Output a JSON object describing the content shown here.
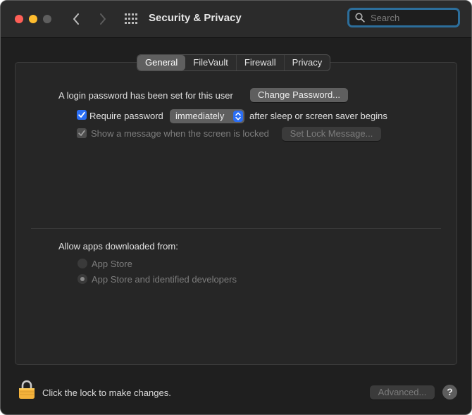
{
  "window": {
    "title": "Security & Privacy",
    "search": {
      "placeholder": "Search",
      "value": ""
    }
  },
  "toolbar": {
    "back_icon": "chevron-left-icon",
    "forward_icon": "chevron-right-icon",
    "show_all_icon": "grid-icon"
  },
  "tabs": [
    {
      "label": "General",
      "selected": true
    },
    {
      "label": "FileVault",
      "selected": false
    },
    {
      "label": "Firewall",
      "selected": false
    },
    {
      "label": "Privacy",
      "selected": false
    }
  ],
  "general": {
    "login_password_text": "A login password has been set for this user",
    "change_password_button": "Change Password...",
    "require_password": {
      "label": "Require password",
      "checked": true,
      "popup_value": "immediately",
      "suffix": "after sleep or screen saver begins"
    },
    "show_message": {
      "label": "Show a message when the screen is locked",
      "checked": true,
      "enabled": false,
      "button": "Set Lock Message..."
    },
    "allow_apps": {
      "label": "Allow apps downloaded from:",
      "options": [
        {
          "label": "App Store",
          "selected": false,
          "enabled": false
        },
        {
          "label": "App Store and identified developers",
          "selected": true,
          "enabled": false
        }
      ]
    }
  },
  "footer": {
    "lock_text": "Click the lock to make changes.",
    "advanced_button": "Advanced...",
    "help_label": "?"
  },
  "colors": {
    "accent": "#2a6ef5",
    "search_focus_ring": "#2c6e9b",
    "lock_gold": "#f4b23b"
  }
}
